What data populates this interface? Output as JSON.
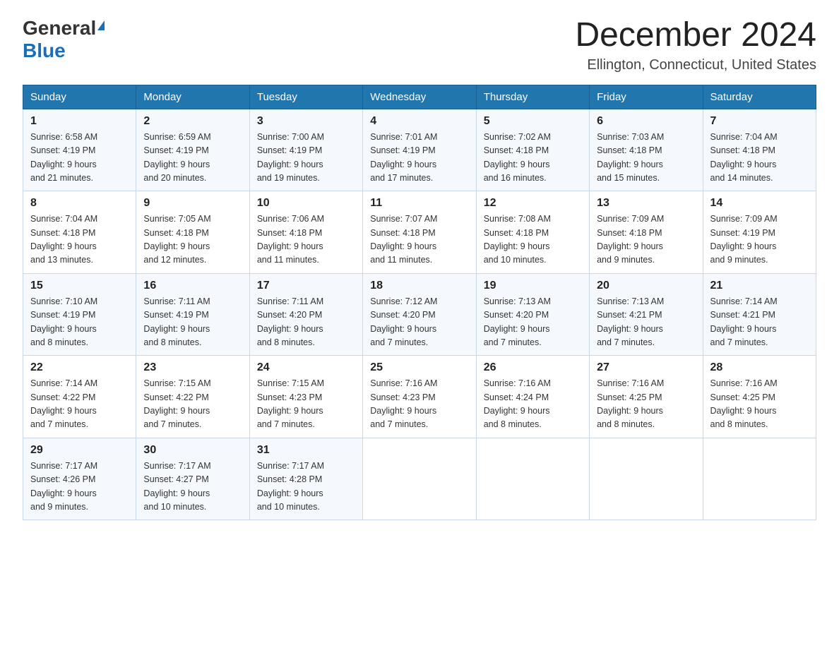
{
  "header": {
    "logo_general": "General",
    "logo_blue": "Blue",
    "month_title": "December 2024",
    "location": "Ellington, Connecticut, United States"
  },
  "days_of_week": [
    "Sunday",
    "Monday",
    "Tuesday",
    "Wednesday",
    "Thursday",
    "Friday",
    "Saturday"
  ],
  "weeks": [
    [
      {
        "day": "1",
        "sunrise": "6:58 AM",
        "sunset": "4:19 PM",
        "daylight": "9 hours and 21 minutes."
      },
      {
        "day": "2",
        "sunrise": "6:59 AM",
        "sunset": "4:19 PM",
        "daylight": "9 hours and 20 minutes."
      },
      {
        "day": "3",
        "sunrise": "7:00 AM",
        "sunset": "4:19 PM",
        "daylight": "9 hours and 19 minutes."
      },
      {
        "day": "4",
        "sunrise": "7:01 AM",
        "sunset": "4:19 PM",
        "daylight": "9 hours and 17 minutes."
      },
      {
        "day": "5",
        "sunrise": "7:02 AM",
        "sunset": "4:18 PM",
        "daylight": "9 hours and 16 minutes."
      },
      {
        "day": "6",
        "sunrise": "7:03 AM",
        "sunset": "4:18 PM",
        "daylight": "9 hours and 15 minutes."
      },
      {
        "day": "7",
        "sunrise": "7:04 AM",
        "sunset": "4:18 PM",
        "daylight": "9 hours and 14 minutes."
      }
    ],
    [
      {
        "day": "8",
        "sunrise": "7:04 AM",
        "sunset": "4:18 PM",
        "daylight": "9 hours and 13 minutes."
      },
      {
        "day": "9",
        "sunrise": "7:05 AM",
        "sunset": "4:18 PM",
        "daylight": "9 hours and 12 minutes."
      },
      {
        "day": "10",
        "sunrise": "7:06 AM",
        "sunset": "4:18 PM",
        "daylight": "9 hours and 11 minutes."
      },
      {
        "day": "11",
        "sunrise": "7:07 AM",
        "sunset": "4:18 PM",
        "daylight": "9 hours and 11 minutes."
      },
      {
        "day": "12",
        "sunrise": "7:08 AM",
        "sunset": "4:18 PM",
        "daylight": "9 hours and 10 minutes."
      },
      {
        "day": "13",
        "sunrise": "7:09 AM",
        "sunset": "4:18 PM",
        "daylight": "9 hours and 9 minutes."
      },
      {
        "day": "14",
        "sunrise": "7:09 AM",
        "sunset": "4:19 PM",
        "daylight": "9 hours and 9 minutes."
      }
    ],
    [
      {
        "day": "15",
        "sunrise": "7:10 AM",
        "sunset": "4:19 PM",
        "daylight": "9 hours and 8 minutes."
      },
      {
        "day": "16",
        "sunrise": "7:11 AM",
        "sunset": "4:19 PM",
        "daylight": "9 hours and 8 minutes."
      },
      {
        "day": "17",
        "sunrise": "7:11 AM",
        "sunset": "4:20 PM",
        "daylight": "9 hours and 8 minutes."
      },
      {
        "day": "18",
        "sunrise": "7:12 AM",
        "sunset": "4:20 PM",
        "daylight": "9 hours and 7 minutes."
      },
      {
        "day": "19",
        "sunrise": "7:13 AM",
        "sunset": "4:20 PM",
        "daylight": "9 hours and 7 minutes."
      },
      {
        "day": "20",
        "sunrise": "7:13 AM",
        "sunset": "4:21 PM",
        "daylight": "9 hours and 7 minutes."
      },
      {
        "day": "21",
        "sunrise": "7:14 AM",
        "sunset": "4:21 PM",
        "daylight": "9 hours and 7 minutes."
      }
    ],
    [
      {
        "day": "22",
        "sunrise": "7:14 AM",
        "sunset": "4:22 PM",
        "daylight": "9 hours and 7 minutes."
      },
      {
        "day": "23",
        "sunrise": "7:15 AM",
        "sunset": "4:22 PM",
        "daylight": "9 hours and 7 minutes."
      },
      {
        "day": "24",
        "sunrise": "7:15 AM",
        "sunset": "4:23 PM",
        "daylight": "9 hours and 7 minutes."
      },
      {
        "day": "25",
        "sunrise": "7:16 AM",
        "sunset": "4:23 PM",
        "daylight": "9 hours and 7 minutes."
      },
      {
        "day": "26",
        "sunrise": "7:16 AM",
        "sunset": "4:24 PM",
        "daylight": "9 hours and 8 minutes."
      },
      {
        "day": "27",
        "sunrise": "7:16 AM",
        "sunset": "4:25 PM",
        "daylight": "9 hours and 8 minutes."
      },
      {
        "day": "28",
        "sunrise": "7:16 AM",
        "sunset": "4:25 PM",
        "daylight": "9 hours and 8 minutes."
      }
    ],
    [
      {
        "day": "29",
        "sunrise": "7:17 AM",
        "sunset": "4:26 PM",
        "daylight": "9 hours and 9 minutes."
      },
      {
        "day": "30",
        "sunrise": "7:17 AM",
        "sunset": "4:27 PM",
        "daylight": "9 hours and 10 minutes."
      },
      {
        "day": "31",
        "sunrise": "7:17 AM",
        "sunset": "4:28 PM",
        "daylight": "9 hours and 10 minutes."
      },
      null,
      null,
      null,
      null
    ]
  ],
  "labels": {
    "sunrise": "Sunrise:",
    "sunset": "Sunset:",
    "daylight": "Daylight:"
  }
}
